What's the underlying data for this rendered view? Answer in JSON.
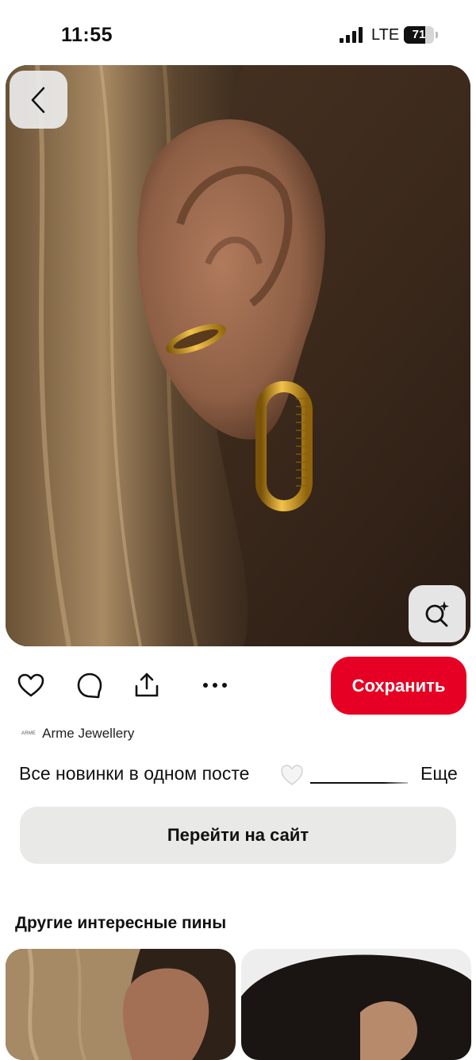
{
  "status_bar": {
    "time": "11:55",
    "network": "LTE",
    "battery_percent": "71",
    "battery_level": 0.71
  },
  "pin": {
    "image_icon": "earring-photo",
    "back_icon": "chevron-left-icon",
    "lens_icon": "visual-search-icon"
  },
  "actions": {
    "like_icon": "heart-icon",
    "comment_icon": "comment-icon",
    "share_icon": "share-icon",
    "more_icon": "more-icon",
    "save_label": "Сохранить"
  },
  "author": {
    "logo_text": "ARME",
    "name": "Arme Jewellery"
  },
  "description": {
    "text": "Все новинки в одном посте",
    "more_label": "Еще"
  },
  "visit_button_label": "Перейти на сайт",
  "more_pins": {
    "title": "Другие интересные пины"
  },
  "colors": {
    "accent": "#e60023",
    "secondary_button": "#e9e9e7"
  }
}
